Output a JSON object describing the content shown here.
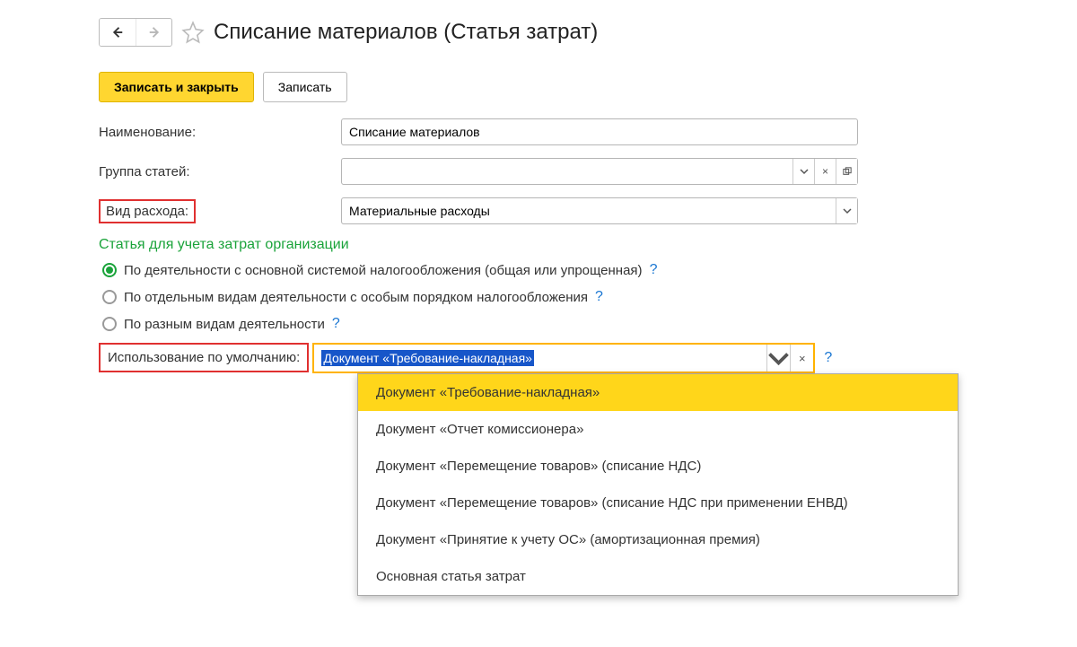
{
  "header": {
    "title": "Списание материалов (Статья затрат)"
  },
  "toolbar": {
    "save_close": "Записать и закрыть",
    "save": "Записать"
  },
  "form": {
    "name_label": "Наименование:",
    "name_value": "Списание материалов",
    "group_label": "Группа статей:",
    "group_value": "",
    "kind_label": "Вид расхода:",
    "kind_value": "Материальные расходы"
  },
  "section": {
    "title": "Статья для учета затрат организации",
    "radios": [
      {
        "label": "По деятельности с основной системой налогообложения (общая или упрощенная)",
        "checked": true
      },
      {
        "label": "По отдельным видам деятельности с особым порядком налогообложения",
        "checked": false
      },
      {
        "label": "По разным видам деятельности",
        "checked": false
      }
    ]
  },
  "usage": {
    "label": "Использование по умолчанию:",
    "selected": "Документ «Требование-накладная»",
    "options": [
      "Документ «Требование-накладная»",
      "Документ «Отчет комиссионера»",
      "Документ «Перемещение товаров» (списание НДС)",
      "Документ «Перемещение товаров» (списание НДС при применении ЕНВД)",
      "Документ «Принятие к учету ОС» (амортизационная премия)",
      "Основная статья затрат"
    ]
  },
  "glyphs": {
    "help": "?",
    "times": "×",
    "open": "▾"
  }
}
